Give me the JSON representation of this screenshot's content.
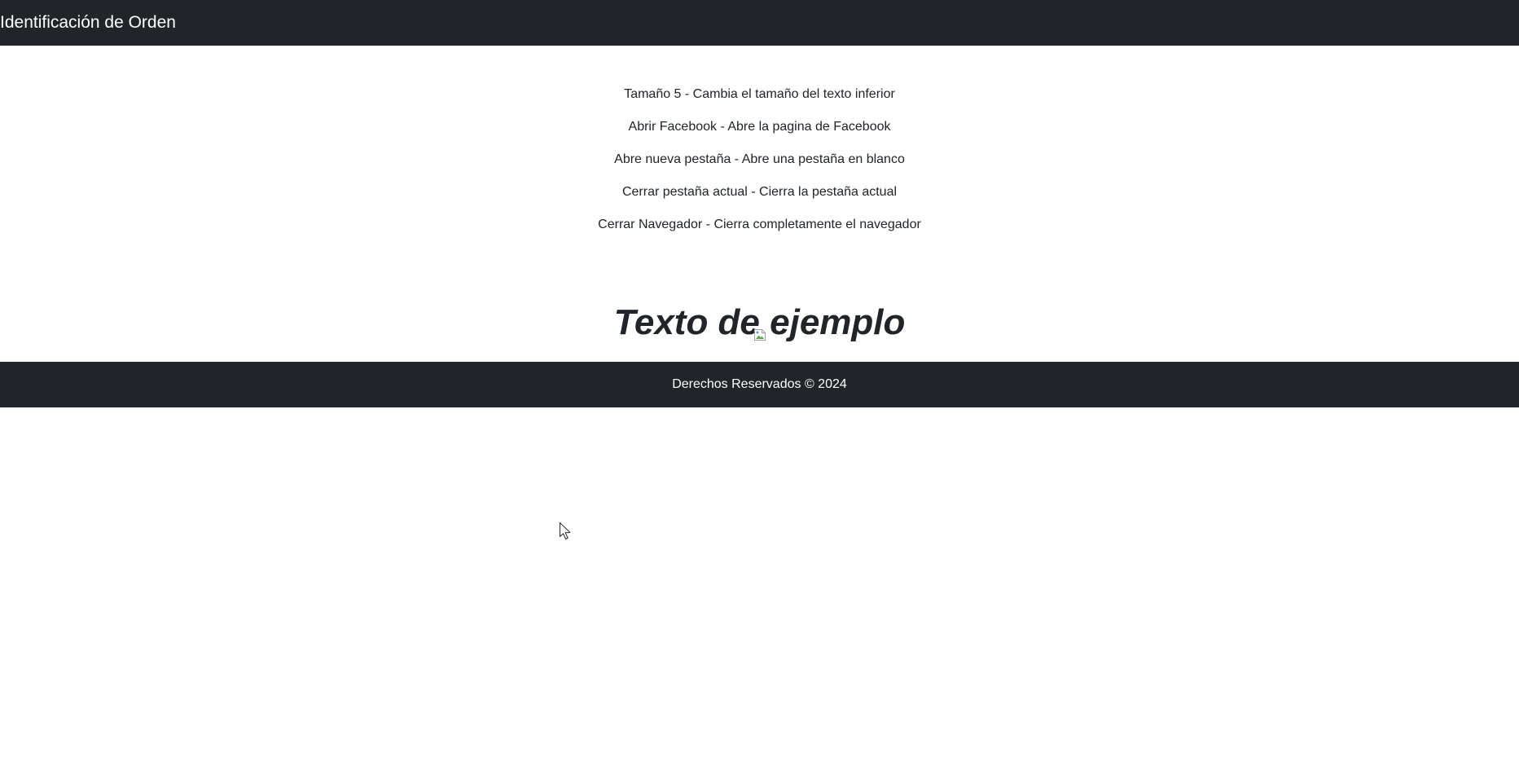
{
  "navbar": {
    "brand": "Identificación de Orden"
  },
  "commands": [
    "Tamaño 5 - Cambia el tamaño del texto inferior",
    "Abrir Facebook - Abre la pagina de Facebook",
    "Abre nueva pestaña - Abre una pestaña en blanco",
    "Cerrar pestaña actual - Cierra la pestaña actual",
    "Cerrar Navegador - Cierra completamente el navegador"
  ],
  "sample": {
    "text": "Texto de ejemplo"
  },
  "footer": {
    "text": "Derechos Reservados © 2024"
  },
  "icons": {
    "image": "broken-image-icon",
    "cursor": "mouse-pointer-icon"
  },
  "colors": {
    "bar_background": "#212529",
    "bar_text": "#ffffff",
    "body_text": "#212529",
    "page_background": "#ffffff"
  }
}
